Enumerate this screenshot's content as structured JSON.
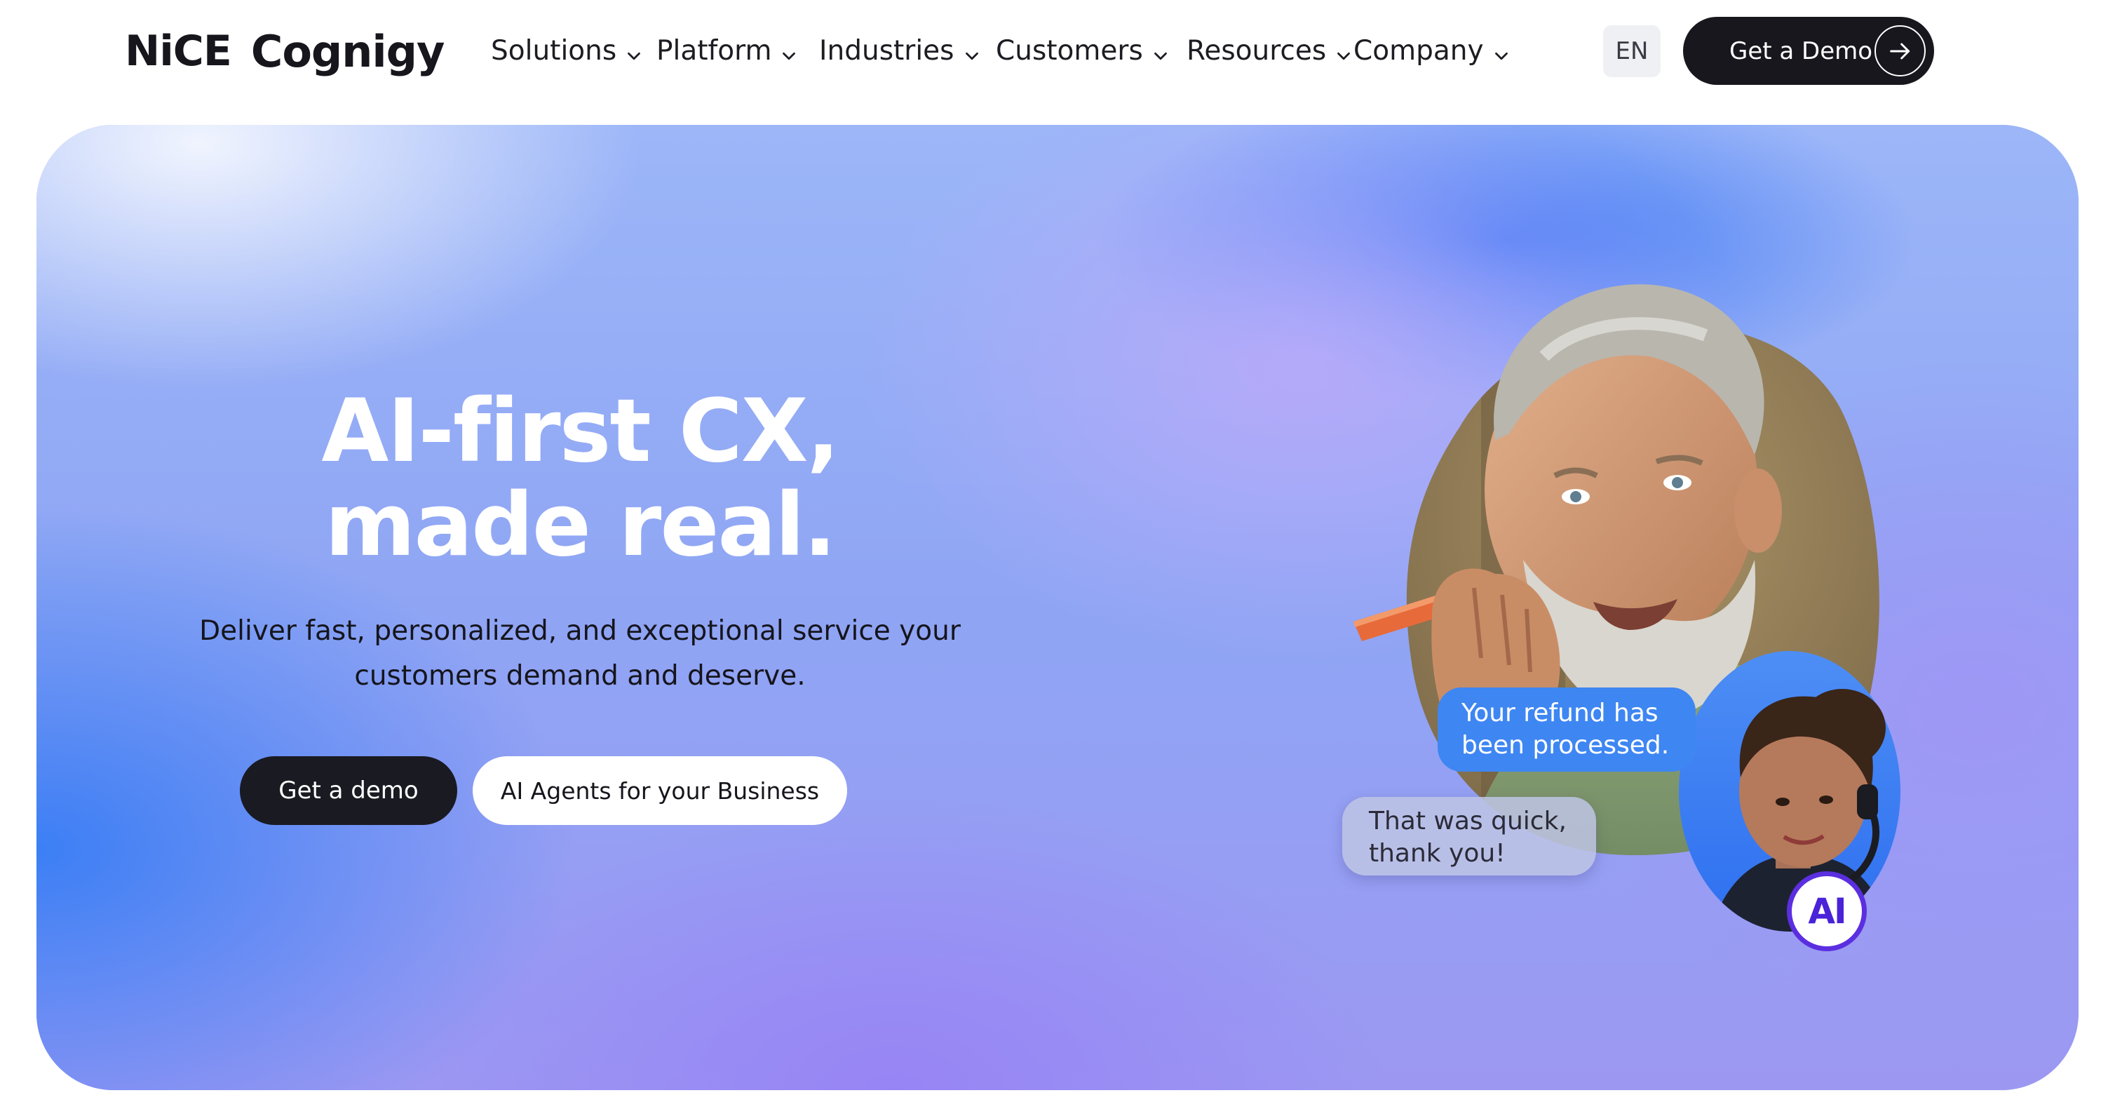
{
  "brand": {
    "logo_part1": "NiCE",
    "logo_part2": "Cognigy"
  },
  "nav": {
    "items": [
      {
        "label": "Solutions",
        "icon": "chevron-down-icon"
      },
      {
        "label": "Platform",
        "icon": "chevron-down-icon"
      },
      {
        "label": "Industries",
        "icon": "chevron-down-icon"
      },
      {
        "label": "Customers",
        "icon": "chevron-down-icon"
      },
      {
        "label": "Resources",
        "icon": "chevron-down-icon"
      },
      {
        "label": "Company",
        "icon": "chevron-down-icon"
      }
    ],
    "language": "EN",
    "demo_button": {
      "label": "Get a Demo",
      "icon": "arrow-right-icon"
    }
  },
  "hero": {
    "title_line1": "AI-first CX,",
    "title_line2": "made real.",
    "subtitle_line1": "Deliver fast, personalized, and exceptional service your",
    "subtitle_line2": "customers demand and deserve.",
    "primary_cta": "Get a demo",
    "secondary_cta": "AI Agents for your Business"
  },
  "illustration": {
    "agent_message_line1": "Your refund has",
    "agent_message_line2": "been processed.",
    "customer_message_line1": "That was quick,",
    "customer_message_line2": "thank you!",
    "ai_badge": "AI"
  },
  "colors": {
    "dark": "#17171d",
    "accent_blue": "#3e86f2",
    "badge_purple": "#5b2fe0"
  }
}
